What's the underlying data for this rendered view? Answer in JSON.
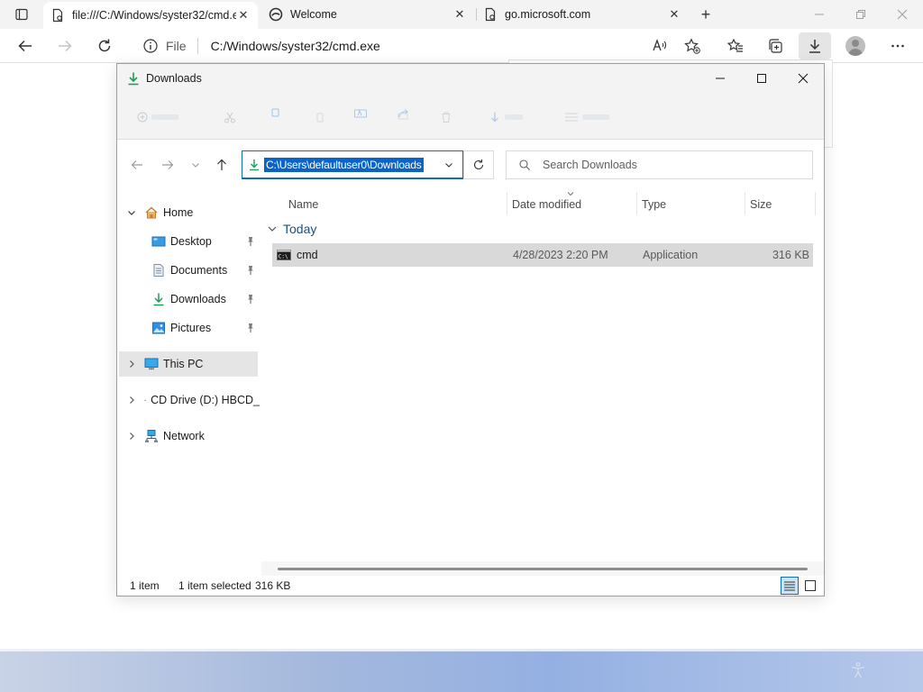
{
  "browser": {
    "tabs": [
      {
        "title": "file:///C:/Windows/syster32/cmd.exe",
        "icon": "file-icon"
      },
      {
        "title": "Welcome",
        "icon": "edge-logo-icon"
      },
      {
        "title": "go.microsoft.com",
        "icon": "file-icon"
      }
    ],
    "address": {
      "scheme": "File",
      "url": "C:/Windows/syster32/cmd.exe"
    }
  },
  "explorer": {
    "title": "Downloads",
    "path": "C:\\Users\\defaultuser0\\Downloads",
    "search_placeholder": "Search Downloads",
    "nav": {
      "home": "Home",
      "quick_access": [
        {
          "label": "Desktop",
          "icon": "desktop-icon"
        },
        {
          "label": "Documents",
          "icon": "documents-icon"
        },
        {
          "label": "Downloads",
          "icon": "downloads-icon"
        },
        {
          "label": "Pictures",
          "icon": "pictures-icon"
        }
      ],
      "this_pc": "This PC",
      "cd_drive": "CD Drive (D:) HBCD_",
      "network": "Network"
    },
    "columns": {
      "name": "Name",
      "date_modified": "Date modified",
      "type": "Type",
      "size": "Size"
    },
    "group": "Today",
    "files": [
      {
        "name": "cmd",
        "date_modified": "4/28/2023 2:20 PM",
        "type": "Application",
        "size": "316 KB"
      }
    ],
    "status": {
      "count": "1 item",
      "selected": "1 item selected",
      "selected_size": "316 KB"
    }
  },
  "colors": {
    "accent": "#0f6cbd",
    "selection_highlight": "#0a64c8",
    "downloads_green": "#1e9e5a"
  }
}
